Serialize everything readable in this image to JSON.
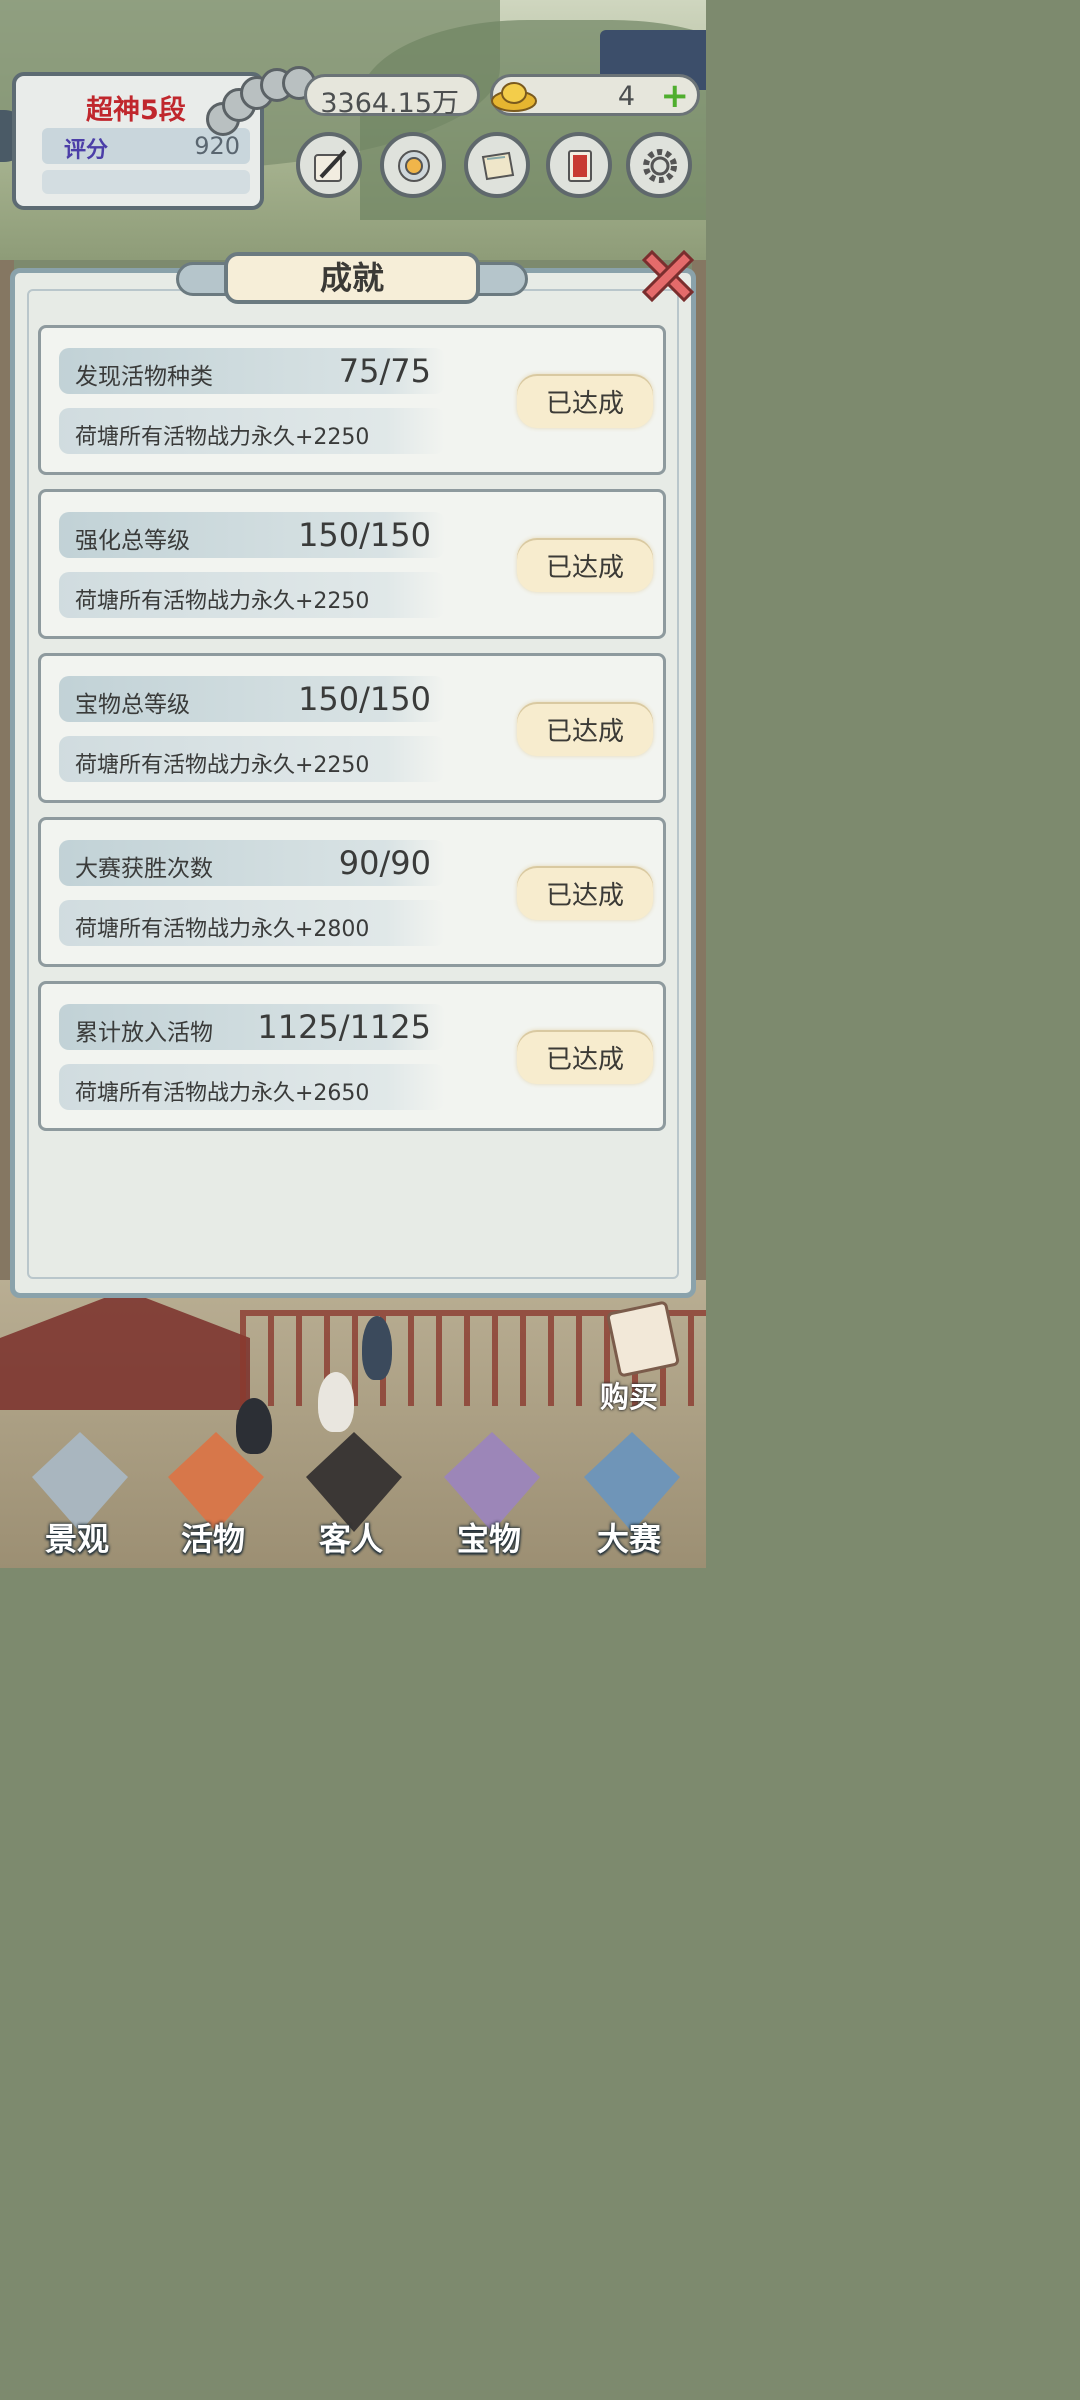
{
  "hud": {
    "rank_title": "超神5段",
    "score_label": "评分",
    "score_value": "920",
    "silver_amount": "3364.15万",
    "gold_amount": "4"
  },
  "toolbar": {
    "icons": [
      "scroll-brush-icon",
      "whirlpool-icon",
      "map-scroll-icon",
      "red-card-icon",
      "gear-icon"
    ]
  },
  "panel": {
    "title": "成就"
  },
  "achievements": [
    {
      "name": "发现活物种类",
      "progress": "75/75",
      "reward": "荷塘所有活物战力永久+2250",
      "status": "已达成"
    },
    {
      "name": "强化总等级",
      "progress": "150/150",
      "reward": "荷塘所有活物战力永久+2250",
      "status": "已达成"
    },
    {
      "name": "宝物总等级",
      "progress": "150/150",
      "reward": "荷塘所有活物战力永久+2250",
      "status": "已达成"
    },
    {
      "name": "大赛获胜次数",
      "progress": "90/90",
      "reward": "荷塘所有活物战力永久+2800",
      "status": "已达成"
    },
    {
      "name": "累计放入活物",
      "progress": "1125/1125",
      "reward": "荷塘所有活物战力永久+2650",
      "status": "已达成"
    }
  ],
  "shop": {
    "buy_label": "购买"
  },
  "nav": {
    "items": [
      {
        "label": "景观"
      },
      {
        "label": "活物"
      },
      {
        "label": "客人"
      },
      {
        "label": "宝物"
      },
      {
        "label": "大赛"
      }
    ]
  },
  "colors": {
    "rank_red": "#c0272d",
    "score_purple": "#4b3ea8",
    "plus_green": "#4fae2e",
    "button_cream": "#f7ecce"
  }
}
